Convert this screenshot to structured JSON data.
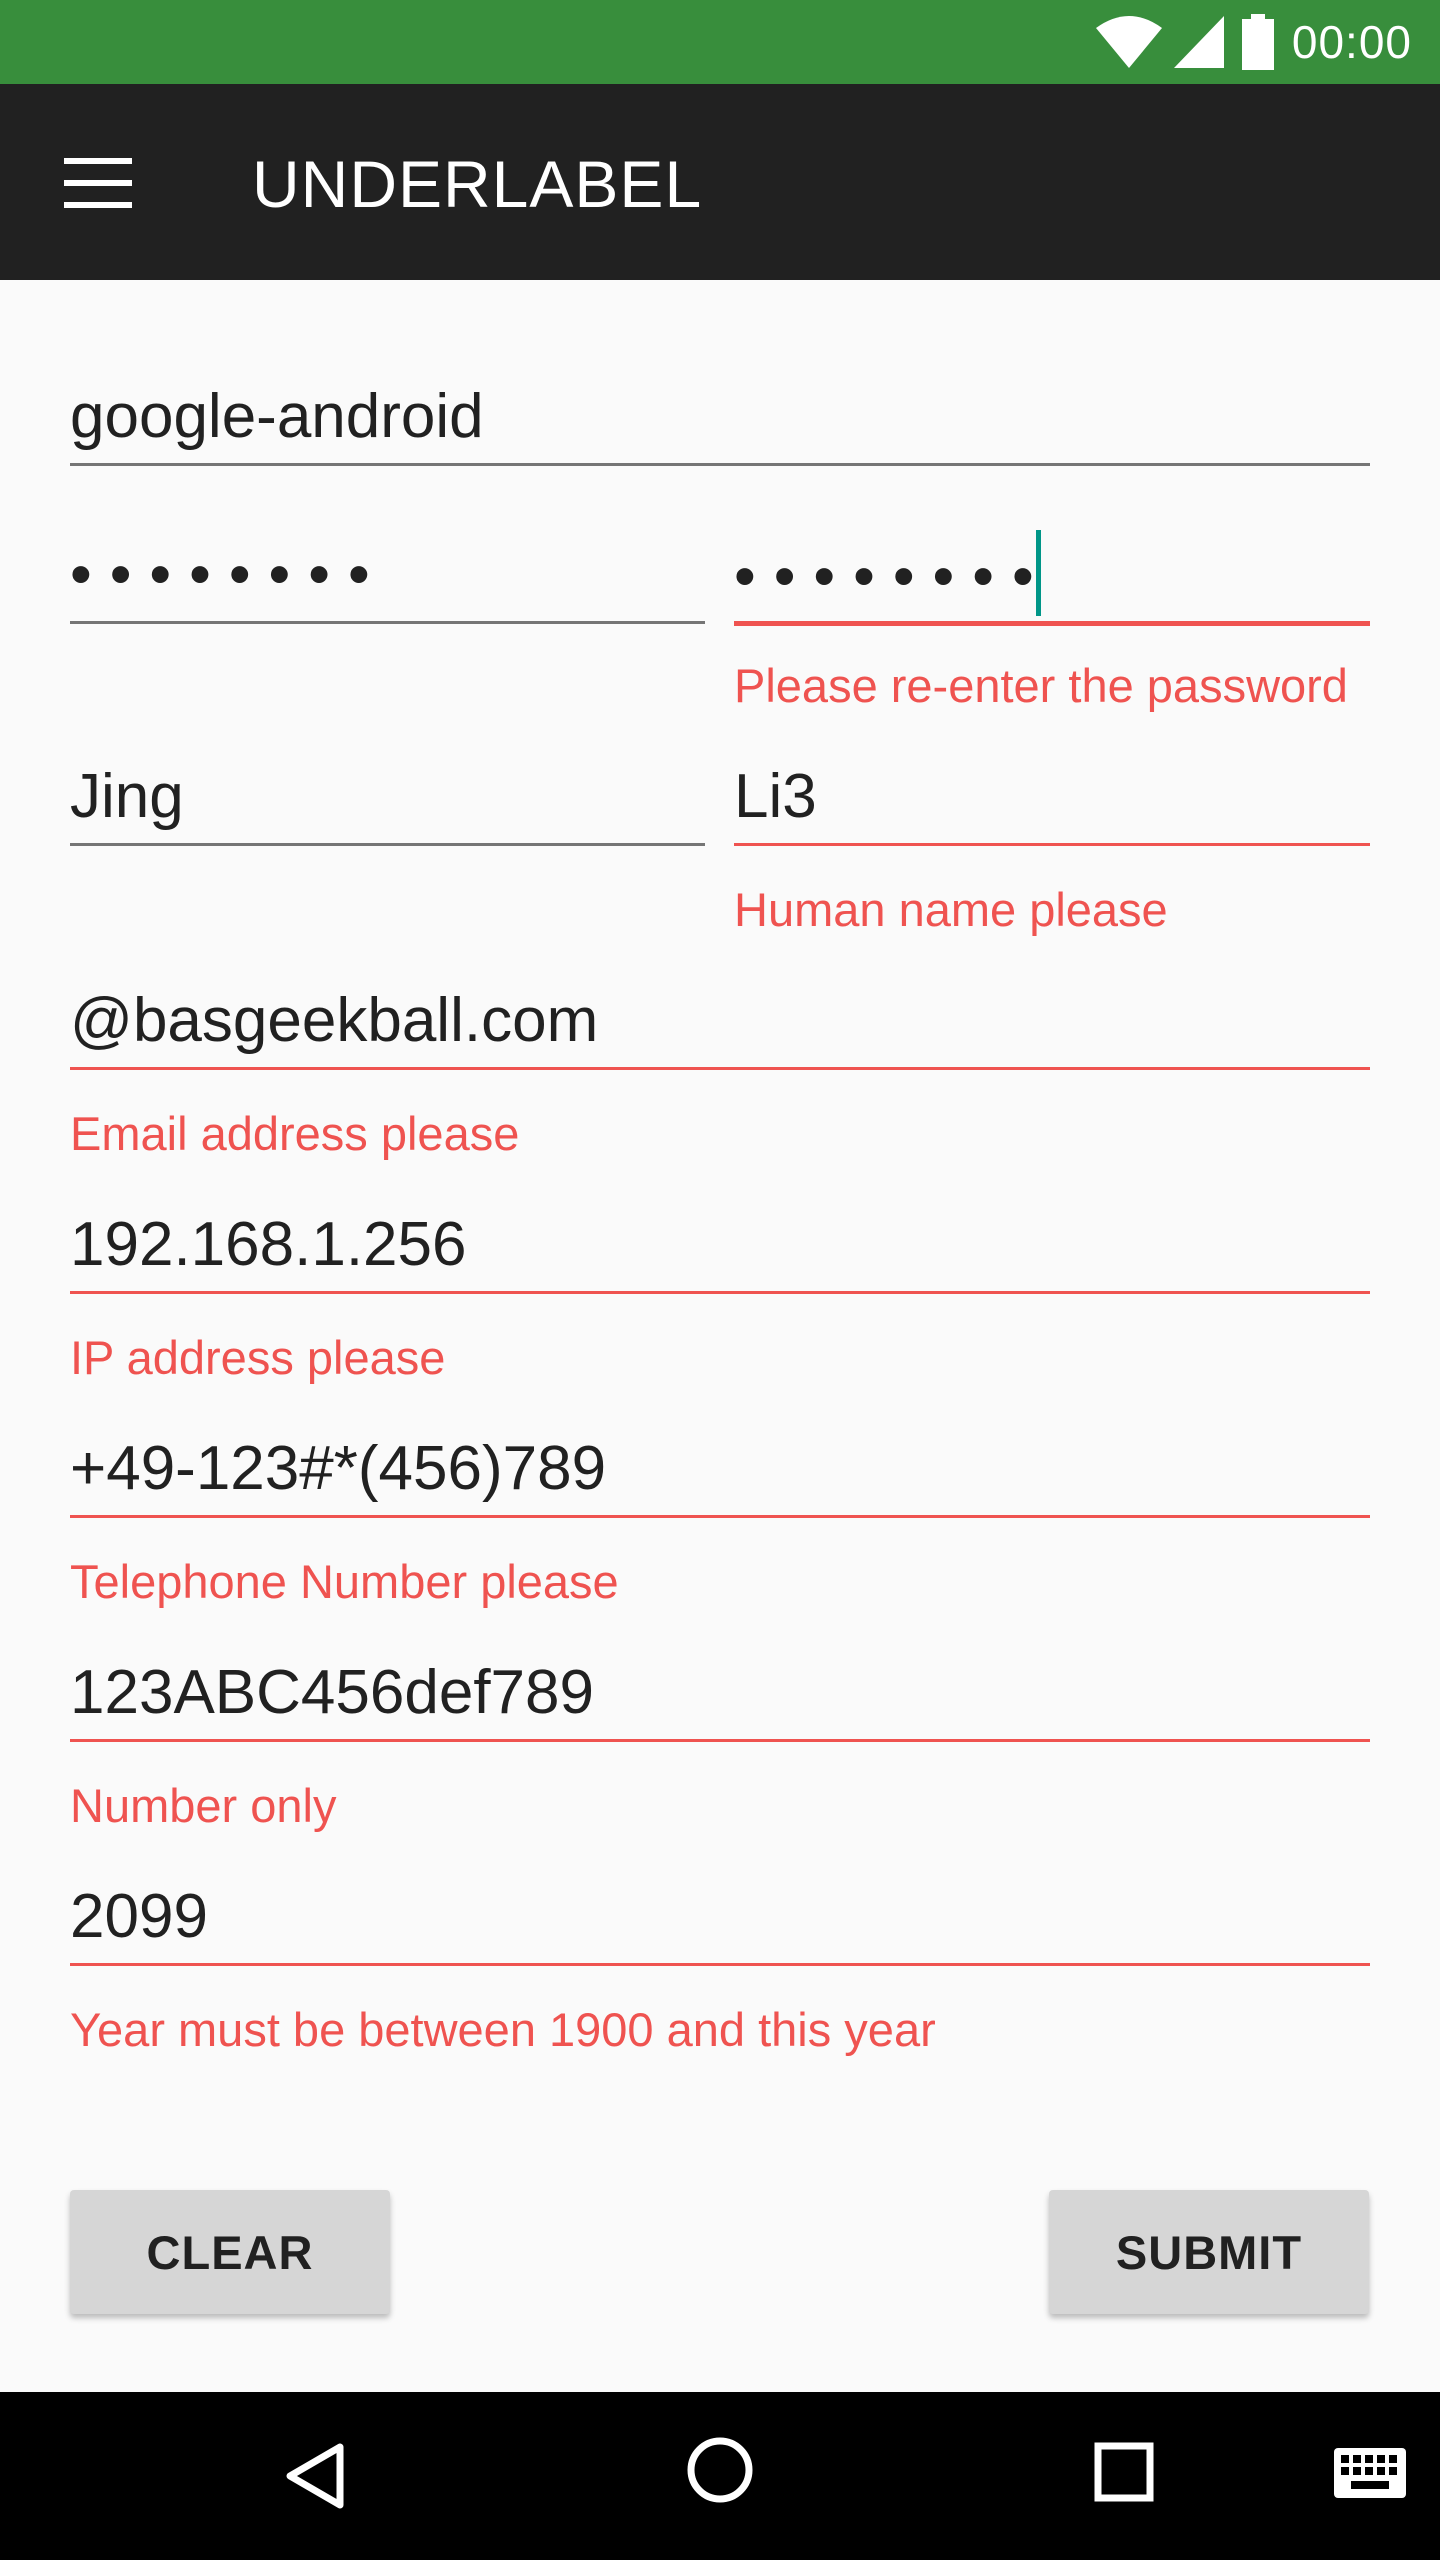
{
  "status_bar": {
    "time": "00:00",
    "icons": [
      "wifi-icon",
      "signal-icon",
      "battery-icon"
    ]
  },
  "app_bar": {
    "title": "UNDERLABEL",
    "menu_icon": "hamburger-menu-icon"
  },
  "form": {
    "username": {
      "value": "google-android"
    },
    "password": {
      "value": "••••••••"
    },
    "confirm_password": {
      "value": "••••••••",
      "error": "Please re-enter the password"
    },
    "first_name": {
      "value": "Jing"
    },
    "last_name": {
      "value": "Li3",
      "error": "Human name please"
    },
    "email": {
      "value": "@basgeekball.com",
      "error": "Email address please"
    },
    "ip": {
      "value": "192.168.1.256",
      "error": "IP address please"
    },
    "phone": {
      "value": "+49-123#*(456)789",
      "error": "Telephone Number please"
    },
    "number": {
      "value": "123ABC456def789",
      "error": "Number only"
    },
    "year": {
      "value": "2099",
      "error": "Year must be between 1900 and this year"
    }
  },
  "buttons": {
    "clear": "CLEAR",
    "submit": "SUBMIT"
  },
  "nav_bar": {
    "icons": [
      "back-icon",
      "home-icon",
      "recents-icon",
      "keyboard-icon"
    ]
  },
  "colors": {
    "status_bar": "#388e3c",
    "app_bar": "#212121",
    "error": "#ef5350",
    "cursor": "#009688",
    "background": "#fafafa"
  }
}
